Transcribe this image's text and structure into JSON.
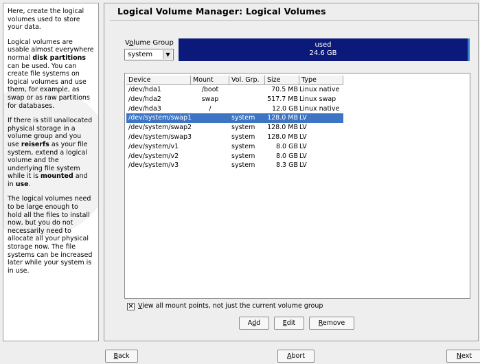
{
  "help": {
    "p1": "Here, create the logical volumes used to store your data.",
    "p2_a": "Logical volumes are usable almost everywhere normal ",
    "p2_b": "disk partitions",
    "p2_c": " can be used. You can create file systems on logical volumes and use them, for example, as swap or as raw partitions for databases.",
    "p3_a": "If there is still unallocated physical storage in a volume group and you use ",
    "p3_b": "reiserfs",
    "p3_c": " as your file system, extend a logical volume and the underlying file system while it is ",
    "p3_d": "mounted",
    "p3_e": " and in ",
    "p3_f": "use",
    "p3_g": ".",
    "p4": "The logical volumes need to be large enough to hold all the files to install now, but you do not necessarily need to allocate all your physical storage now. The file systems can be increased later while your system is in use."
  },
  "title": "Logical Volume Manager: Logical Volumes",
  "volume_group": {
    "label_pre": "V",
    "label_u": "o",
    "label_post": "lume Group",
    "selected": "system",
    "bar_line1": "used",
    "bar_line2": "24.6 GB"
  },
  "table": {
    "headers": [
      "Device",
      "Mount",
      "Vol. Grp.",
      "Size",
      "Type"
    ],
    "rows": [
      {
        "device": "/dev/hda1",
        "mount": "/boot",
        "vg": "",
        "size": "70.5 MB",
        "type": "Linux native",
        "selected": false
      },
      {
        "device": "/dev/hda2",
        "mount": "swap",
        "vg": "",
        "size": "517.7 MB",
        "type": "Linux swap",
        "selected": false
      },
      {
        "device": "/dev/hda3",
        "mount": "/",
        "vg": "",
        "size": "12.0 GB",
        "type": "Linux native",
        "selected": false
      },
      {
        "device": "/dev/system/swap1",
        "mount": "",
        "vg": "system",
        "size": "128.0 MB",
        "type": "LV",
        "selected": true
      },
      {
        "device": "/dev/system/swap2",
        "mount": "",
        "vg": "system",
        "size": "128.0 MB",
        "type": "LV",
        "selected": false
      },
      {
        "device": "/dev/system/swap3",
        "mount": "",
        "vg": "system",
        "size": "128.0 MB",
        "type": "LV",
        "selected": false
      },
      {
        "device": "/dev/system/v1",
        "mount": "",
        "vg": "system",
        "size": "8.0 GB",
        "type": "LV",
        "selected": false
      },
      {
        "device": "/dev/system/v2",
        "mount": "",
        "vg": "system",
        "size": "8.0 GB",
        "type": "LV",
        "selected": false
      },
      {
        "device": "/dev/system/v3",
        "mount": "",
        "vg": "system",
        "size": "8.3 GB",
        "type": "LV",
        "selected": false
      }
    ]
  },
  "checkbox": {
    "checked_mark": "✕",
    "label_u": "V",
    "label_rest": "iew all mount points, not just the current volume group"
  },
  "buttons": {
    "add": {
      "pre": "A",
      "u": "d",
      "post": "d"
    },
    "edit": {
      "pre": "",
      "u": "E",
      "post": "dit"
    },
    "remove": {
      "pre": "",
      "u": "R",
      "post": "emove"
    },
    "back": {
      "pre": "",
      "u": "B",
      "post": "ack"
    },
    "abort": {
      "pre": "",
      "u": "A",
      "post": "bort"
    },
    "next": {
      "pre": "",
      "u": "N",
      "post": "ext"
    }
  },
  "colors": {
    "selection": "#3d75c4",
    "volume_bar": "#0b1a7a"
  }
}
